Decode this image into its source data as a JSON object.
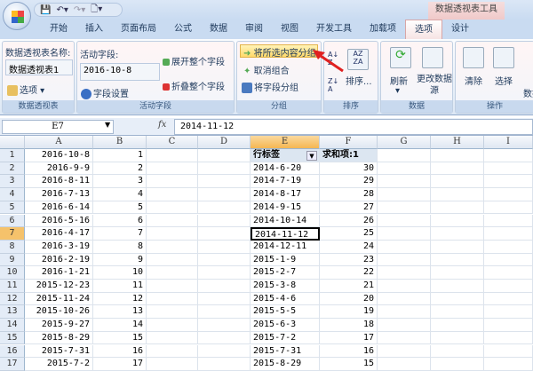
{
  "quick_access": {
    "save": "save-icon",
    "undo": "undo-icon",
    "redo": "redo-icon",
    "preview": "print-preview-icon"
  },
  "context_tab_title": "数据透视表工具",
  "tabs": [
    "开始",
    "插入",
    "页面布局",
    "公式",
    "数据",
    "审阅",
    "视图",
    "开发工具",
    "加载项",
    "选项",
    "设计"
  ],
  "active_tab": "选项",
  "ribbon": {
    "pivot": {
      "name_label": "数据透视表名称:",
      "name_value": "数据透视表1",
      "options": "选项",
      "group": "数据透视表"
    },
    "active_field": {
      "label": "活动字段:",
      "value": "2016-10-8",
      "settings": "字段设置",
      "expand": "展开整个字段",
      "collapse": "折叠整个字段",
      "group": "活动字段"
    },
    "grouping": {
      "group_selection": "将所选内容分组",
      "ungroup": "取消组合",
      "group_field": "将字段分组",
      "group": "分组"
    },
    "sort": {
      "sort": "排序...",
      "group": "排序"
    },
    "data": {
      "refresh": "刷新",
      "change_source": "更改数据源",
      "group": "数据"
    },
    "actions": {
      "clear": "清除",
      "select": "选择",
      "move": "数据",
      "group": "操作"
    }
  },
  "formula_bar": {
    "name_box": "E7",
    "fx": "fx",
    "value": "2014-11-12"
  },
  "columns": [
    "A",
    "B",
    "C",
    "D",
    "E",
    "F",
    "G",
    "H",
    "I"
  ],
  "selected_cell": "E7",
  "pivot_headers": {
    "row_label": "行标签",
    "sum": "求和项:1"
  },
  "rows": [
    {
      "a": "2016-10-8",
      "b": "1",
      "e": "2014-6-20",
      "f": "30"
    },
    {
      "a": "2016-9-9",
      "b": "2",
      "e": "2014-7-19",
      "f": "29"
    },
    {
      "a": "2016-8-11",
      "b": "3",
      "e": "2014-8-17",
      "f": "28"
    },
    {
      "a": "2016-7-13",
      "b": "4",
      "e": "2014-9-15",
      "f": "27"
    },
    {
      "a": "2016-6-14",
      "b": "5",
      "e": "2014-10-14",
      "f": "26"
    },
    {
      "a": "2016-5-16",
      "b": "6",
      "e": "2014-11-12",
      "f": "25"
    },
    {
      "a": "2016-4-17",
      "b": "7",
      "e": "2014-12-11",
      "f": "24"
    },
    {
      "a": "2016-3-19",
      "b": "8",
      "e": "2015-1-9",
      "f": "23"
    },
    {
      "a": "2016-2-19",
      "b": "9",
      "e": "2015-2-7",
      "f": "22"
    },
    {
      "a": "2016-1-21",
      "b": "10",
      "e": "2015-3-8",
      "f": "21"
    },
    {
      "a": "2015-12-23",
      "b": "11",
      "e": "2015-4-6",
      "f": "20"
    },
    {
      "a": "2015-11-24",
      "b": "12",
      "e": "2015-5-5",
      "f": "19"
    },
    {
      "a": "2015-10-26",
      "b": "13",
      "e": "2015-6-3",
      "f": "18"
    },
    {
      "a": "2015-9-27",
      "b": "14",
      "e": "2015-7-2",
      "f": "17"
    },
    {
      "a": "2015-8-29",
      "b": "15",
      "e": "2015-7-31",
      "f": "16"
    },
    {
      "a": "2015-7-31",
      "b": "16",
      "e": "2015-8-29",
      "f": "15"
    },
    {
      "a": "2015-7-2",
      "b": "17"
    }
  ]
}
